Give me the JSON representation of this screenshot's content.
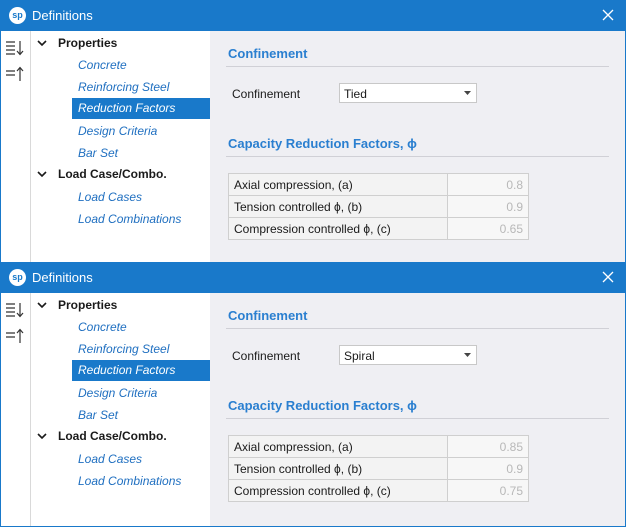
{
  "colors": {
    "title_bar": "#1979ca",
    "accent_text": "#2a7fd0",
    "tree_link": "#1f6fc0",
    "selection": "#1979ca",
    "content_bg": "#efeff3"
  },
  "windows": [
    {
      "app_logo": "sp",
      "title": "Definitions",
      "toolstrip": {
        "icons": [
          "expand-all-icon",
          "collapse-all-icon"
        ]
      },
      "tree": {
        "groups": [
          {
            "label": "Properties",
            "items": [
              {
                "label": "Concrete",
                "selected": false
              },
              {
                "label": "Reinforcing Steel",
                "selected": false
              },
              {
                "label": "Reduction Factors",
                "selected": true
              },
              {
                "label": "Design Criteria",
                "selected": false
              },
              {
                "label": "Bar Set",
                "selected": false
              }
            ]
          },
          {
            "label": "Load Case/Combo.",
            "items": [
              {
                "label": "Load Cases",
                "selected": false
              },
              {
                "label": "Load Combinations",
                "selected": false
              }
            ]
          }
        ]
      },
      "content": {
        "confinement_section_title": "Confinement",
        "confinement_label": "Confinement",
        "confinement_value": "Tied",
        "factors_section_title": "Capacity Reduction Factors, ϕ",
        "factors": [
          {
            "label": "Axial compression, (a)",
            "value": "0.8"
          },
          {
            "label": "Tension controlled ϕ, (b)",
            "value": "0.9"
          },
          {
            "label": "Compression controlled ϕ, (c)",
            "value": "0.65"
          }
        ]
      }
    },
    {
      "app_logo": "sp",
      "title": "Definitions",
      "toolstrip": {
        "icons": [
          "expand-all-icon",
          "collapse-all-icon"
        ]
      },
      "tree": {
        "groups": [
          {
            "label": "Properties",
            "items": [
              {
                "label": "Concrete",
                "selected": false
              },
              {
                "label": "Reinforcing Steel",
                "selected": false
              },
              {
                "label": "Reduction Factors",
                "selected": true
              },
              {
                "label": "Design Criteria",
                "selected": false
              },
              {
                "label": "Bar Set",
                "selected": false
              }
            ]
          },
          {
            "label": "Load Case/Combo.",
            "items": [
              {
                "label": "Load Cases",
                "selected": false
              },
              {
                "label": "Load Combinations",
                "selected": false
              }
            ]
          }
        ]
      },
      "content": {
        "confinement_section_title": "Confinement",
        "confinement_label": "Confinement",
        "confinement_value": "Spiral",
        "factors_section_title": "Capacity Reduction Factors, ϕ",
        "factors": [
          {
            "label": "Axial compression, (a)",
            "value": "0.85"
          },
          {
            "label": "Tension controlled ϕ, (b)",
            "value": "0.9"
          },
          {
            "label": "Compression controlled ϕ, (c)",
            "value": "0.75"
          }
        ]
      }
    }
  ]
}
